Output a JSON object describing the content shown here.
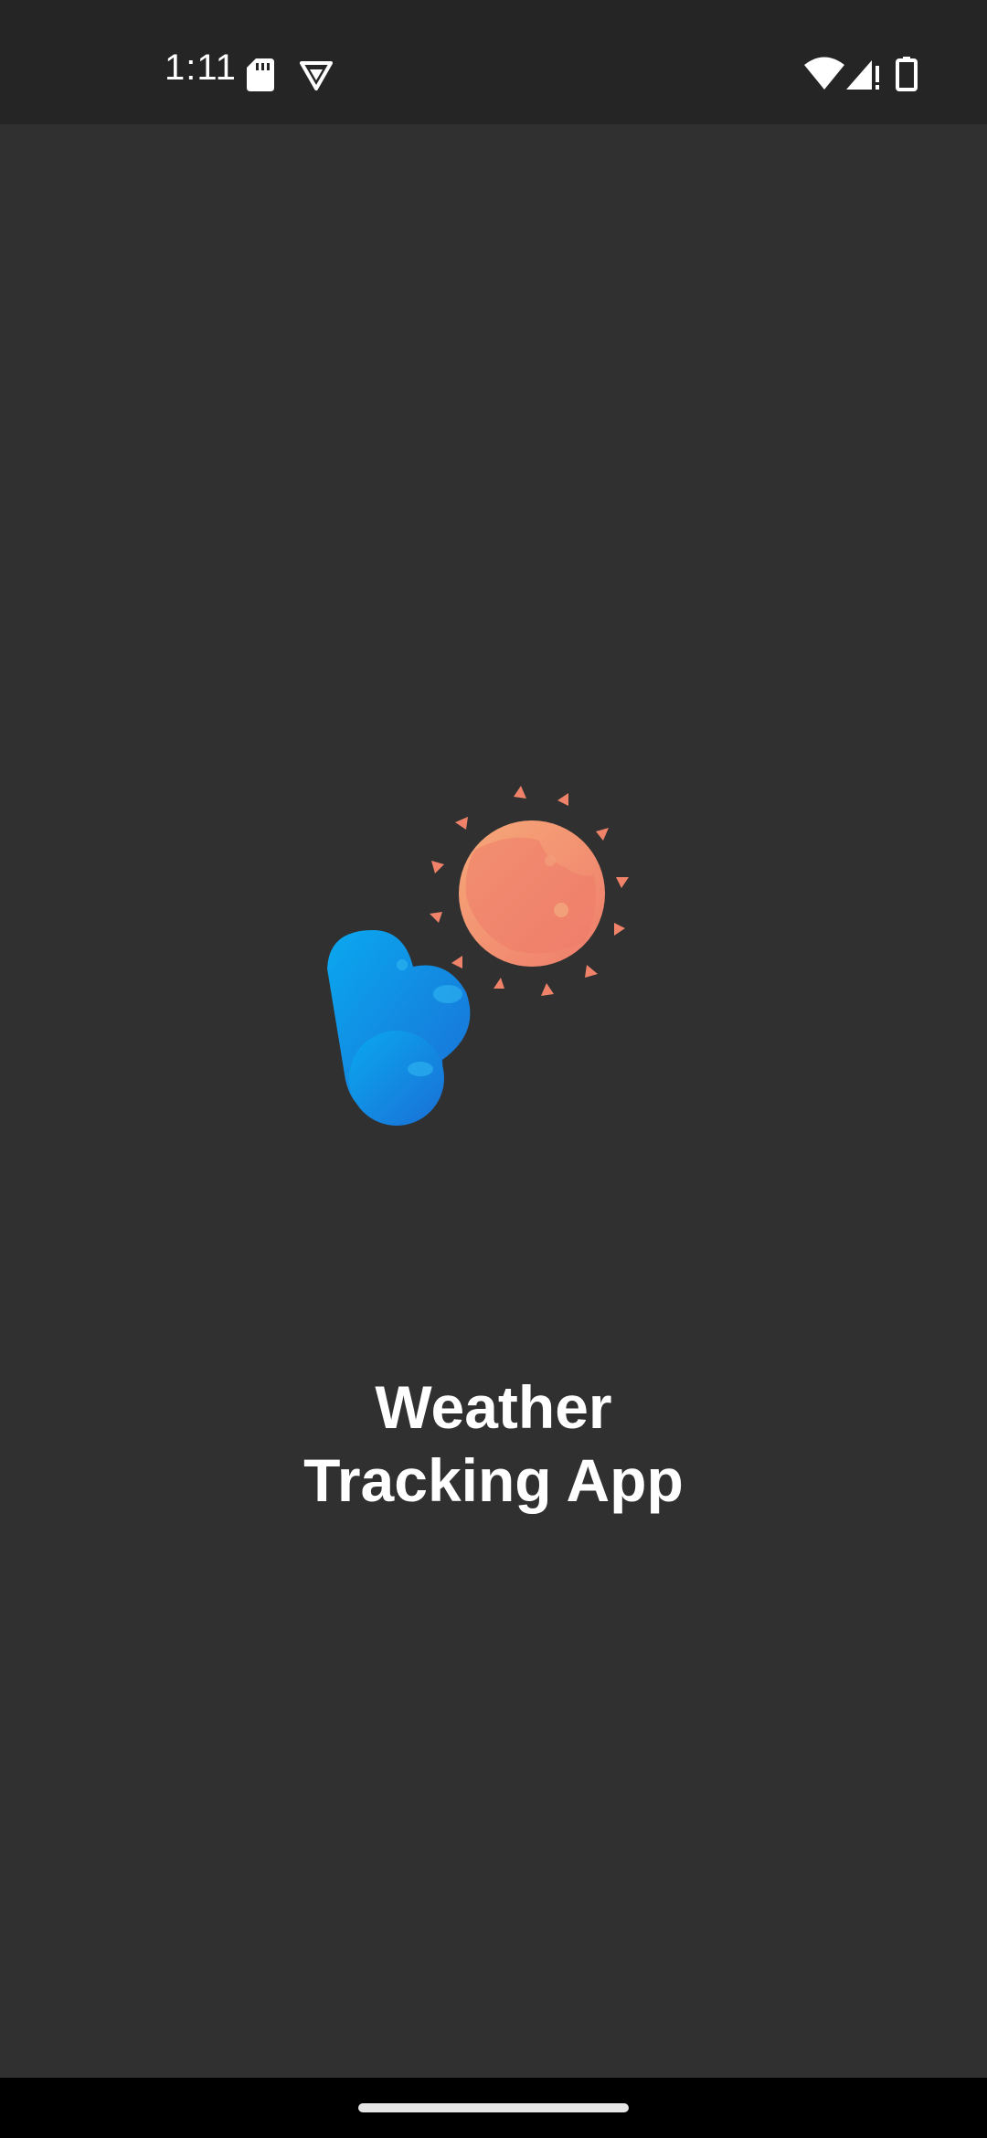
{
  "status_bar": {
    "time": "1:11",
    "icons": [
      "sd-card-icon",
      "vpn-shield-icon",
      "wifi-icon",
      "cell-signal-icon",
      "battery-icon"
    ]
  },
  "splash": {
    "title_line_1": "Weather",
    "title_line_2": "Tracking App",
    "logo_icon": "weather-logo-icon"
  },
  "colors": {
    "background": "#303030",
    "status_bar": "#252525",
    "sun": "#f39a78",
    "sun_rays": "#f0826a",
    "cloud": "#1e9be8",
    "text": "#ffffff"
  }
}
